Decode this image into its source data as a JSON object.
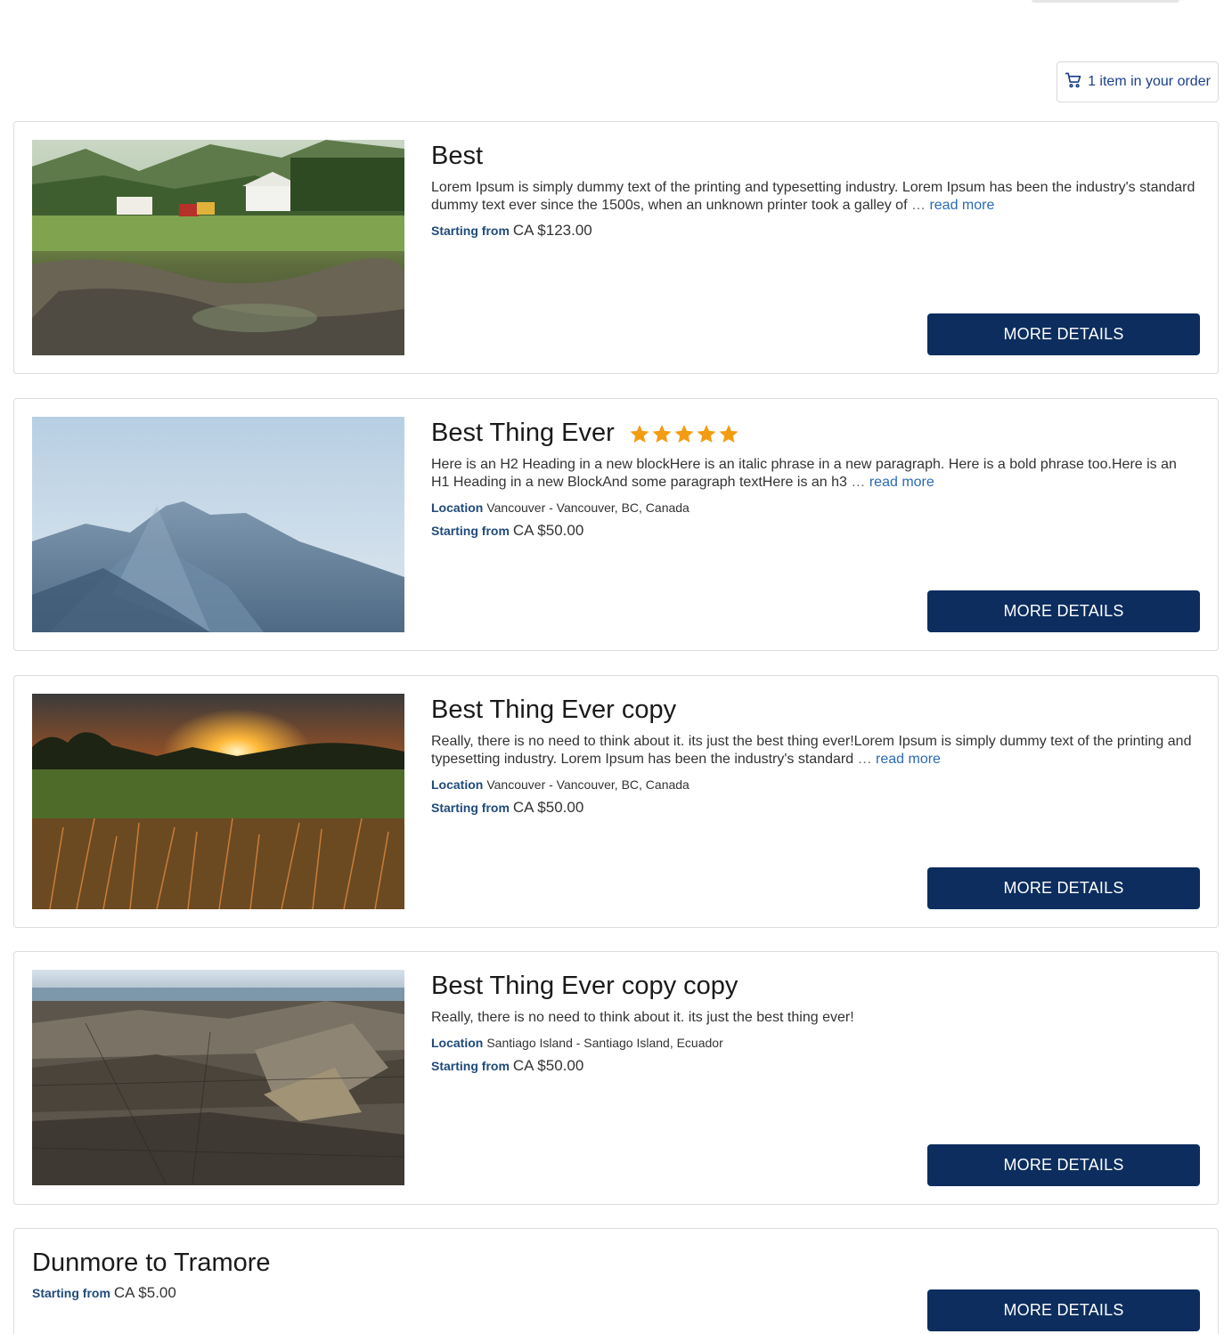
{
  "cart": {
    "icon": "cart-icon",
    "label": "1 item in your order"
  },
  "colors": {
    "accent": "#0c2d5e",
    "link": "#2a6bb3",
    "label": "#1f4a7a",
    "star": "#f39c12"
  },
  "labels": {
    "location": "Location",
    "starting_from": "Starting from",
    "more_details": "MORE DETAILS",
    "read_more": "read more",
    "ellipsis": "…"
  },
  "products": [
    {
      "title": "Best",
      "image": "meadow-farmhouse-image",
      "rating": null,
      "description": "Lorem Ipsum is simply dummy text of the printing and typesetting industry. Lorem Ipsum has been the industry's standard dummy text ever since the 1500s, when an unknown printer took a galley of",
      "truncated": true,
      "location": null,
      "price": "CA $123.00"
    },
    {
      "title": "Best Thing Ever",
      "image": "misty-mountain-image",
      "rating": 5,
      "description": "Here is an H2 Heading in a new blockHere is an italic phrase in a new paragraph. Here is a bold phrase too.Here is an H1 Heading in a new BlockAnd some paragraph textHere is an h3",
      "truncated": true,
      "location": "Vancouver - Vancouver, BC, Canada",
      "price": "CA $50.00"
    },
    {
      "title": "Best Thing Ever copy",
      "image": "sunset-field-image",
      "rating": null,
      "description": "Really, there is no need to think about it. its just the best thing ever!Lorem Ipsum is simply dummy text of the printing and typesetting industry. Lorem Ipsum has been the industry's standard",
      "truncated": true,
      "location": "Vancouver - Vancouver, BC, Canada",
      "price": "CA $50.00"
    },
    {
      "title": "Best Thing Ever copy copy",
      "image": "rocky-coast-image",
      "rating": null,
      "description": "Really, there is no need to think about it. its just the best thing ever!",
      "truncated": false,
      "location": "Santiago Island - Santiago Island, Ecuador",
      "price": "CA $50.00"
    },
    {
      "title": "Dunmore to Tramore",
      "image": null,
      "rating": null,
      "description": null,
      "truncated": false,
      "location": null,
      "price": "CA $5.00"
    }
  ]
}
